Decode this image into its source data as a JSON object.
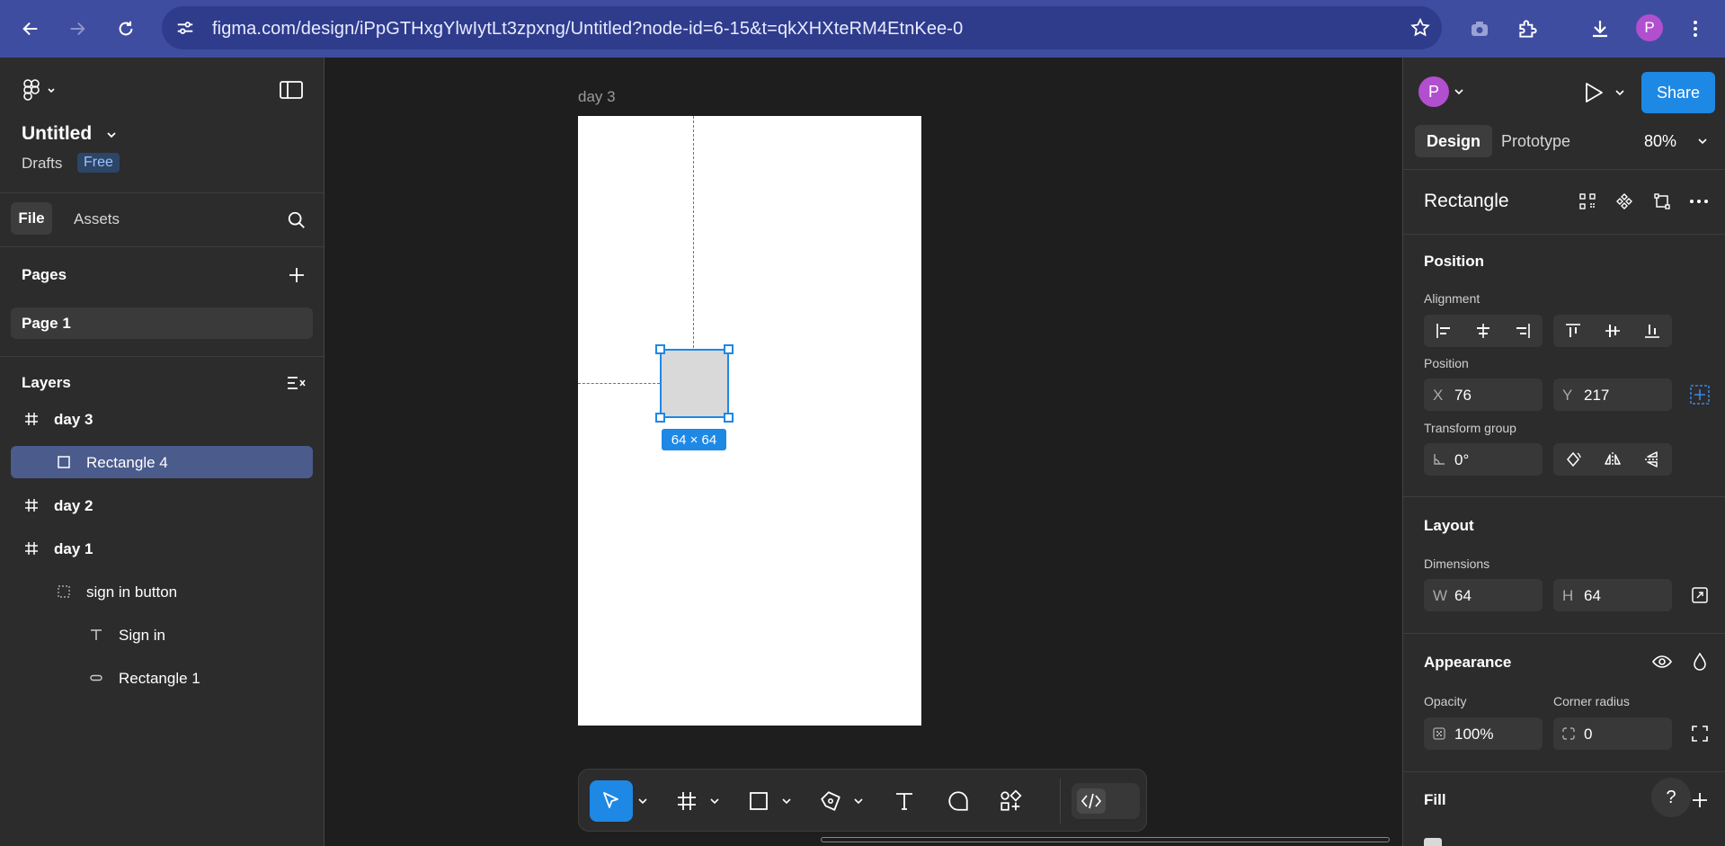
{
  "browser": {
    "url": "figma.com/design/iPpGTHxgYlwIytLt3zpxng/Untitled?node-id=6-15&t=qkXHXteRM4EtnKee-0",
    "profile_initial": "P"
  },
  "left_panel": {
    "file_title": "Untitled",
    "drafts_label": "Drafts",
    "plan_badge": "Free",
    "tabs": {
      "file": "File",
      "assets": "Assets"
    },
    "pages_heading": "Pages",
    "pages": [
      {
        "label": "Page 1"
      }
    ],
    "layers_heading": "Layers",
    "layers": [
      {
        "label": "day 3",
        "kind": "frame"
      },
      {
        "label": "Rectangle 4",
        "kind": "rectangle",
        "selected": true
      },
      {
        "label": "day 2",
        "kind": "frame"
      },
      {
        "label": "day 1",
        "kind": "frame"
      },
      {
        "label": "sign in button",
        "kind": "group"
      },
      {
        "label": "Sign in",
        "kind": "text"
      },
      {
        "label": "Rectangle 1",
        "kind": "rounded-rectangle"
      }
    ]
  },
  "canvas": {
    "frame_label": "day 3",
    "selection_size": "64 × 64",
    "frame_fill": "#ffffff",
    "rect_fill": "#d9d9d9",
    "selection_color": "#1e88e5"
  },
  "toolbar": {
    "tools": [
      "move",
      "frame",
      "rectangle",
      "pen",
      "text",
      "comment",
      "actions",
      "dev-mode"
    ],
    "active_tool": "move"
  },
  "right_panel": {
    "avatar_initial": "P",
    "share_label": "Share",
    "tabs": {
      "design": "Design",
      "prototype": "Prototype"
    },
    "zoom": "80%",
    "object_title": "Rectangle",
    "position_heading": "Position",
    "alignment_label": "Alignment",
    "position_label": "Position",
    "x": {
      "prefix": "X",
      "value": "76"
    },
    "y": {
      "prefix": "Y",
      "value": "217"
    },
    "transform_label": "Transform group",
    "rotation": "0°",
    "layout_heading": "Layout",
    "dimensions_label": "Dimensions",
    "w": {
      "prefix": "W",
      "value": "64"
    },
    "h": {
      "prefix": "H",
      "value": "64"
    },
    "appearance_heading": "Appearance",
    "opacity_label": "Opacity",
    "opacity": "100%",
    "corner_radius_label": "Corner radius",
    "corner_radius": "0",
    "fill_heading": "Fill",
    "help_label": "?"
  }
}
